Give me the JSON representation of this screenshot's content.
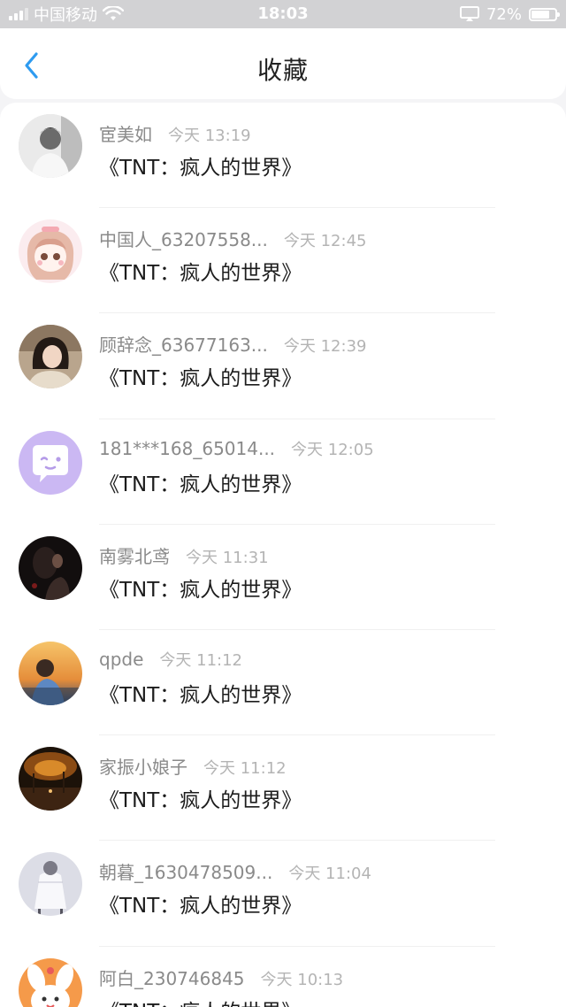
{
  "status_bar": {
    "carrier": "中国移动",
    "time": "18:03",
    "battery": "72%"
  },
  "header": {
    "title": "收藏",
    "back_icon": "chevron-left-icon"
  },
  "colors": {
    "accent": "#2e9bf0",
    "status_bar_bg": "#d2d2d4"
  },
  "favorites": [
    {
      "name": "宦美如",
      "time": "今天 13:19",
      "title": "《TNT：疯人的世界》"
    },
    {
      "name": "中国人_63207558...",
      "time": "今天 12:45",
      "title": "《TNT：疯人的世界》"
    },
    {
      "name": "顾辞念_63677163...",
      "time": "今天 12:39",
      "title": "《TNT：疯人的世界》"
    },
    {
      "name": "181***168_65014...",
      "time": "今天 12:05",
      "title": "《TNT：疯人的世界》"
    },
    {
      "name": "南雾北鸢",
      "time": "今天 11:31",
      "title": "《TNT：疯人的世界》"
    },
    {
      "name": "qpde",
      "time": "今天 11:12",
      "title": "《TNT：疯人的世界》"
    },
    {
      "name": "家振小娘子",
      "time": "今天 11:12",
      "title": "《TNT：疯人的世界》"
    },
    {
      "name": "朝暮_1630478509...",
      "time": "今天 11:04",
      "title": "《TNT：疯人的世界》"
    },
    {
      "name": "阿白_230746845",
      "time": "今天 10:13",
      "title": "《TNT：疯人的世界》"
    }
  ]
}
